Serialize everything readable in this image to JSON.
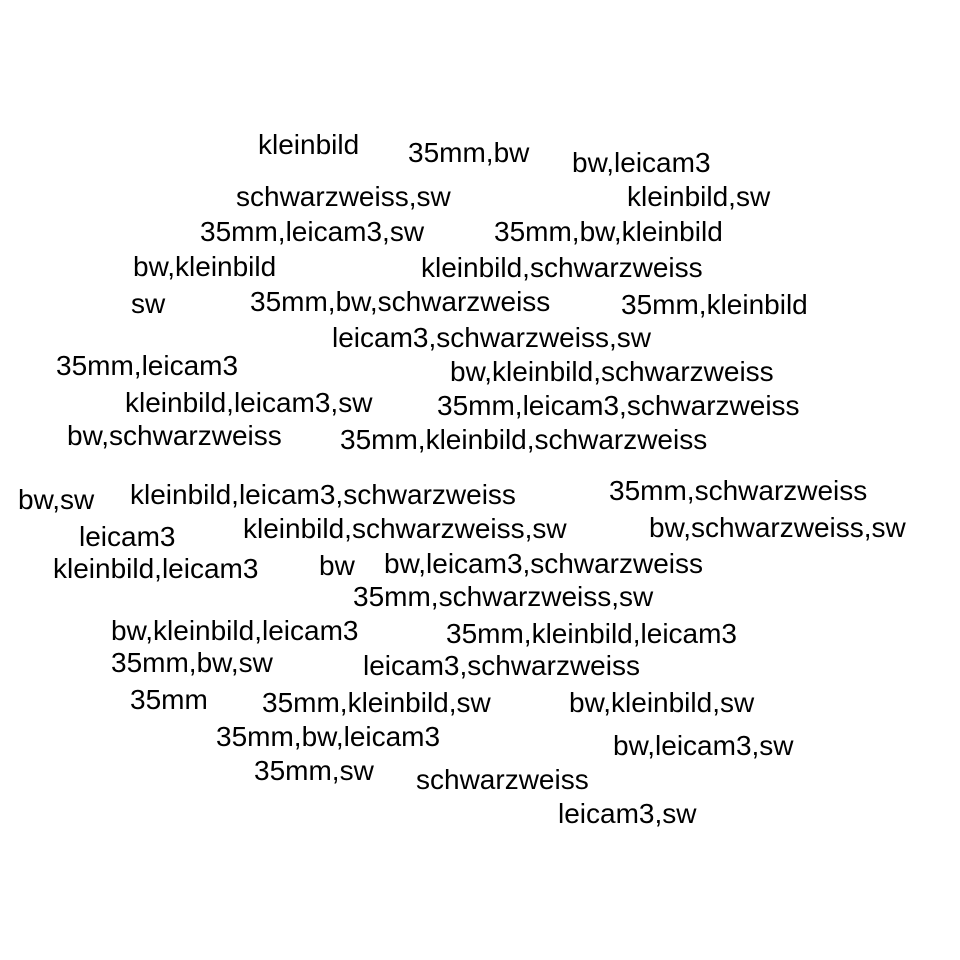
{
  "tags": [
    "kleinbild",
    "35mm,bw",
    "bw,leicam3",
    "schwarzweiss,sw",
    "kleinbild,sw",
    "35mm,leicam3,sw",
    "35mm,bw,kleinbild",
    "bw,kleinbild",
    "kleinbild,schwarzweiss",
    "sw",
    "35mm,bw,schwarzweiss",
    "35mm,kleinbild",
    "leicam3,schwarzweiss,sw",
    "35mm,leicam3",
    "bw,kleinbild,schwarzweiss",
    "kleinbild,leicam3,sw",
    "35mm,leicam3,schwarzweiss",
    "bw,schwarzweiss",
    "35mm,kleinbild,schwarzweiss",
    "bw,sw",
    "kleinbild,leicam3,schwarzweiss",
    "35mm,schwarzweiss",
    "leicam3",
    "kleinbild,schwarzweiss,sw",
    "bw,schwarzweiss,sw",
    "kleinbild,leicam3",
    "bw",
    "bw,leicam3,schwarzweiss",
    "35mm,schwarzweiss,sw",
    "bw,kleinbild,leicam3",
    "35mm,kleinbild,leicam3",
    "35mm,bw,sw",
    "leicam3,schwarzweiss",
    "35mm",
    "35mm,kleinbild,sw",
    "bw,kleinbild,sw",
    "35mm,bw,leicam3",
    "bw,leicam3,sw",
    "35mm,sw",
    "schwarzweiss",
    "leicam3,sw"
  ]
}
